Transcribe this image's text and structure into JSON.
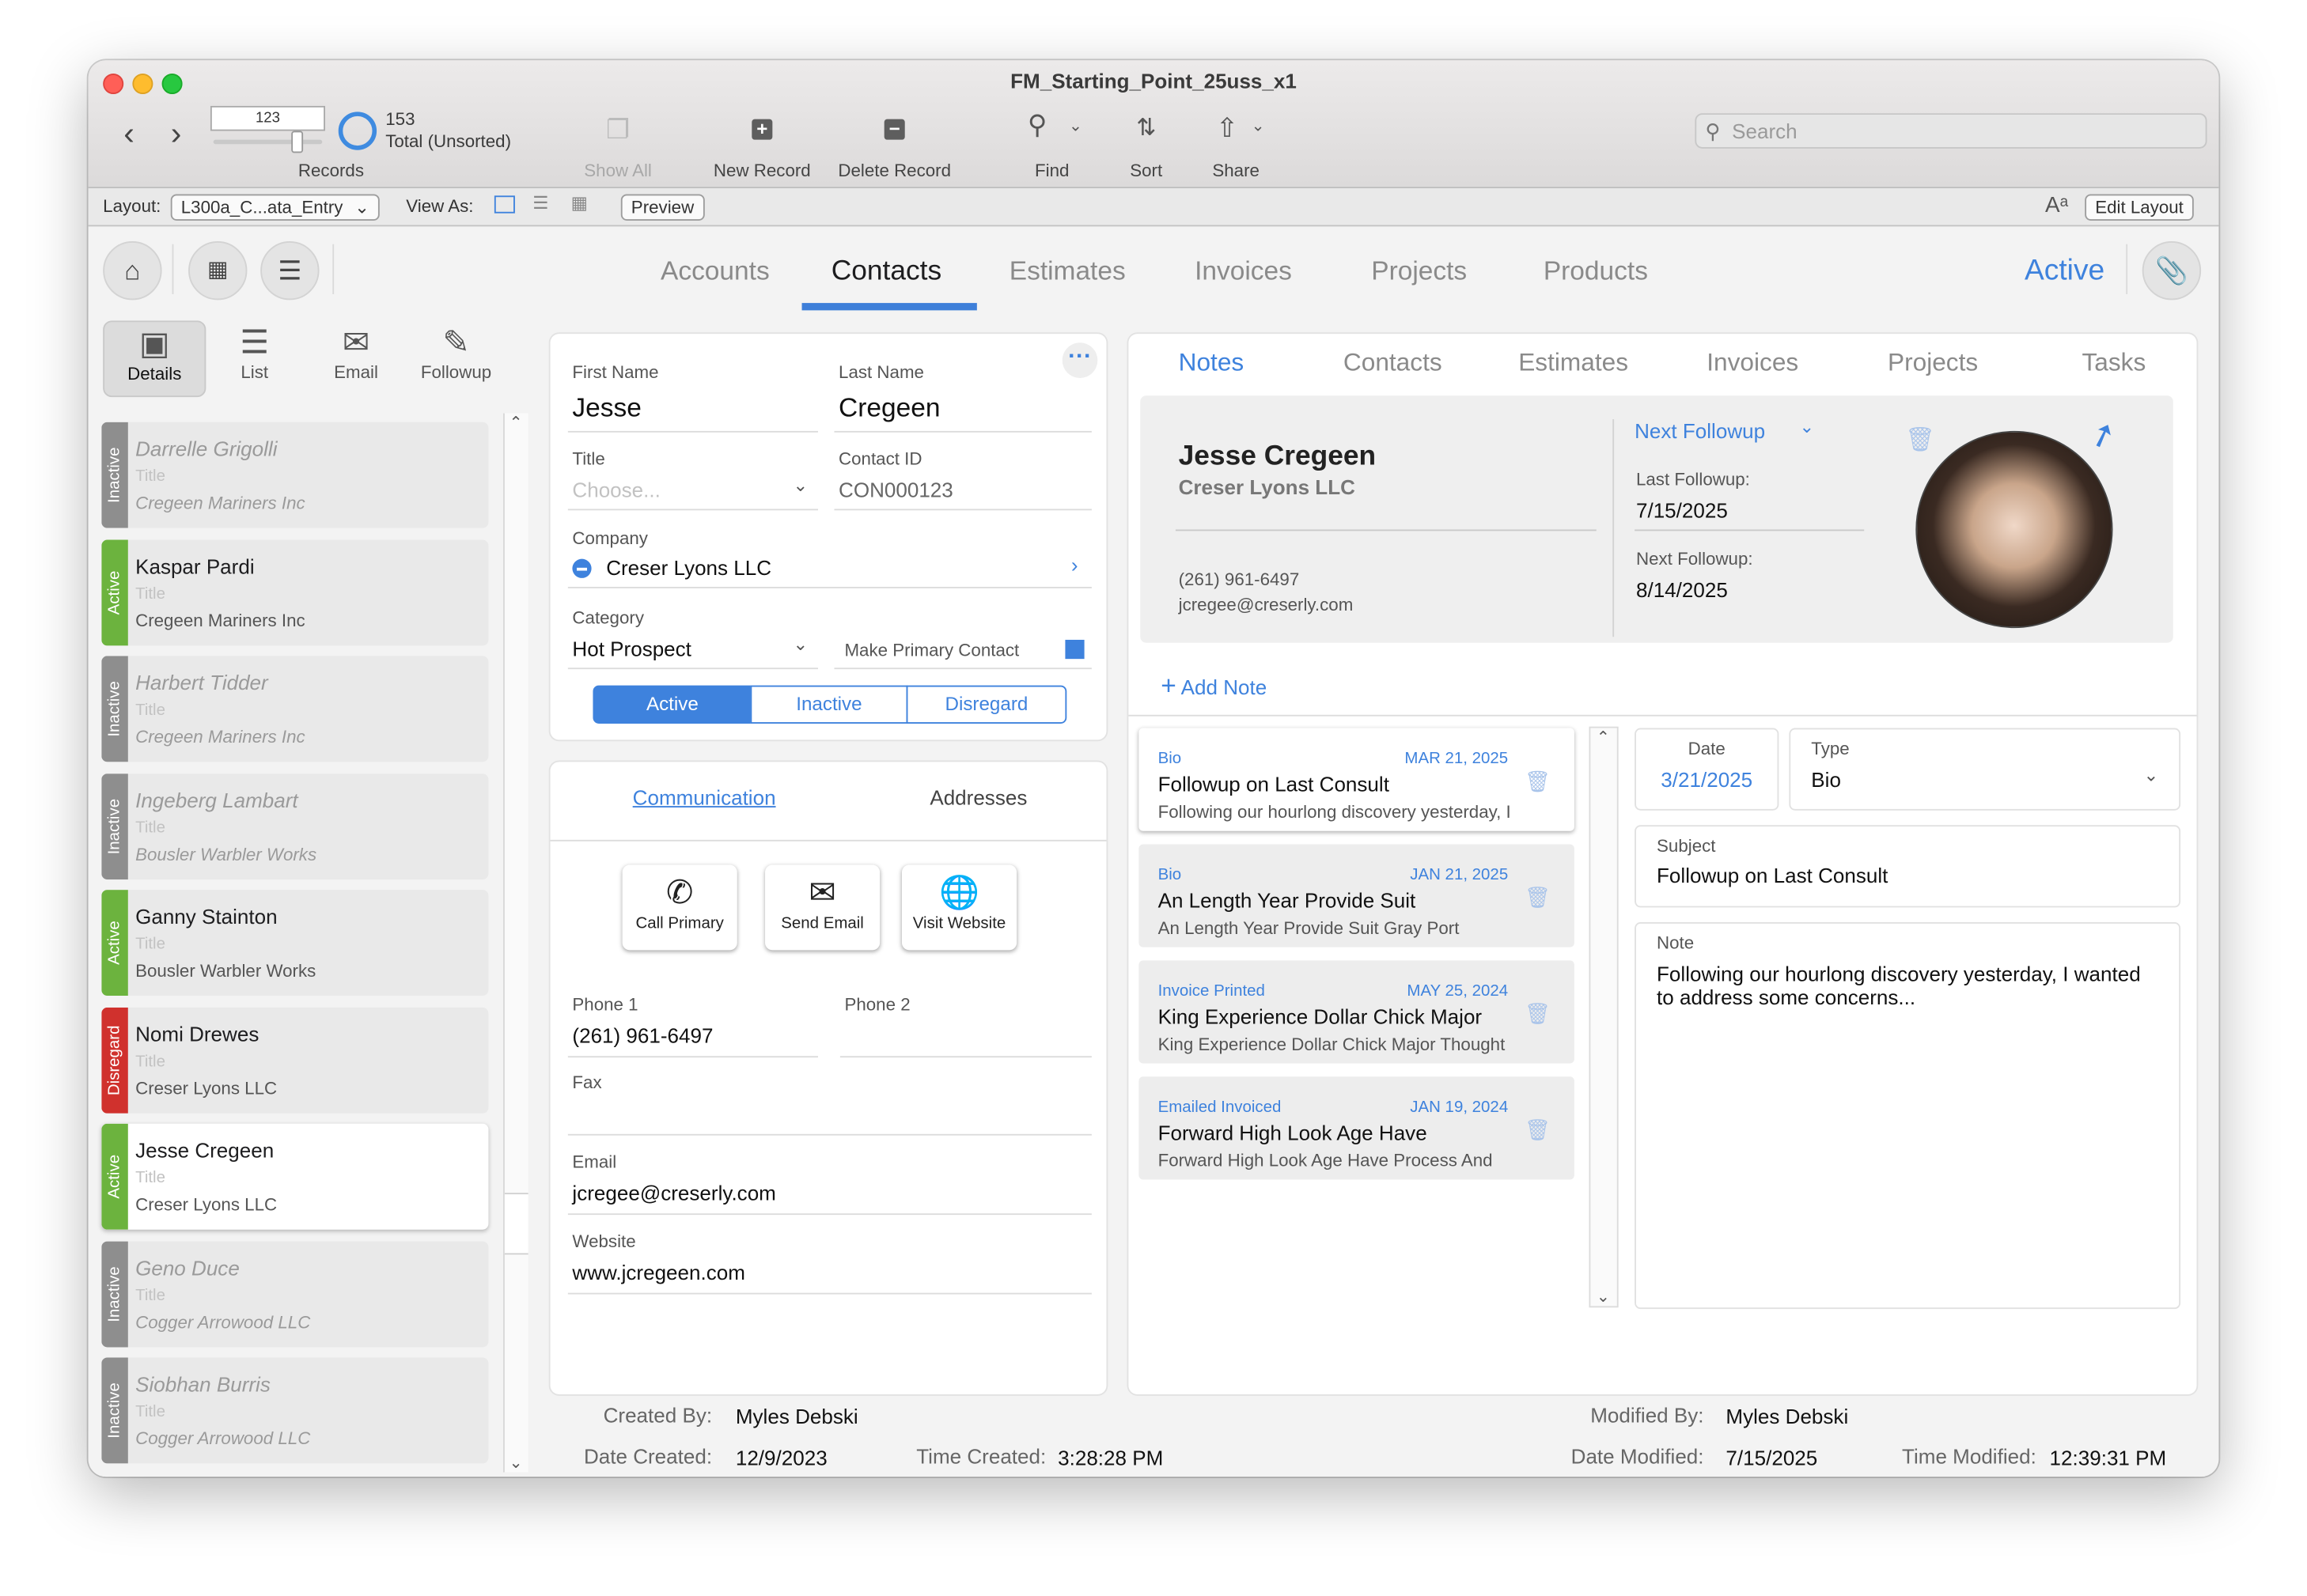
{
  "window": {
    "title": "FM_Starting_Point_25uss_x1"
  },
  "toolbar": {
    "record_number": "123",
    "records_label": "Records",
    "total_count": "153",
    "total_state": "Total (Unsorted)",
    "show_all": "Show All",
    "new_record": "New Record",
    "delete_record": "Delete Record",
    "find": "Find",
    "sort": "Sort",
    "share": "Share",
    "search_placeholder": "Search"
  },
  "layoutbar": {
    "layout_label": "Layout:",
    "layout_value": "L300a_C...ata_Entry",
    "view_as_label": "View As:",
    "preview": "Preview",
    "edit_layout": "Edit Layout"
  },
  "nav": {
    "tabs": [
      "Accounts",
      "Contacts",
      "Estimates",
      "Invoices",
      "Projects",
      "Products"
    ],
    "active_tab": "Contacts",
    "status": "Active"
  },
  "sidebar": {
    "tabs": [
      "Details",
      "List",
      "Email",
      "Followup"
    ],
    "contacts": [
      {
        "name": "Darrelle Grigolli",
        "title": "Title",
        "company": "Cregeen Mariners Inc",
        "status": "Inactive"
      },
      {
        "name": "Kaspar Pardi",
        "title": "Title",
        "company": "Cregeen Mariners Inc",
        "status": "Active"
      },
      {
        "name": "Harbert Tidder",
        "title": "Title",
        "company": "Cregeen Mariners Inc",
        "status": "Inactive"
      },
      {
        "name": "Ingeberg Lambart",
        "title": "Title",
        "company": "Bousler Warbler Works",
        "status": "Inactive"
      },
      {
        "name": "Ganny Stainton",
        "title": "Title",
        "company": "Bousler Warbler Works",
        "status": "Active"
      },
      {
        "name": "Nomi Drewes",
        "title": "Title",
        "company": "Creser Lyons LLC",
        "status": "Disregard"
      },
      {
        "name": "Jesse Cregeen",
        "title": "Title",
        "company": "Creser Lyons LLC",
        "status": "Active"
      },
      {
        "name": "Geno Duce",
        "title": "Title",
        "company": "Cogger Arrowood LLC",
        "status": "Inactive"
      },
      {
        "name": "Siobhan Burris",
        "title": "Title",
        "company": "Cogger Arrowood LLC",
        "status": "Inactive"
      }
    ]
  },
  "contact": {
    "first_name_label": "First Name",
    "first_name": "Jesse",
    "last_name_label": "Last Name",
    "last_name": "Cregeen",
    "title_label": "Title",
    "title_placeholder": "Choose...",
    "contact_id_label": "Contact ID",
    "contact_id": "CON000123",
    "company_label": "Company",
    "company": "Creser Lyons LLC",
    "category_label": "Category",
    "category": "Hot Prospect",
    "make_primary_label": "Make Primary Contact",
    "status_options": [
      "Active",
      "Inactive",
      "Disregard"
    ]
  },
  "communication": {
    "tabs": [
      "Communication",
      "Addresses"
    ],
    "buttons": [
      "Call Primary",
      "Send Email",
      "Visit Website"
    ],
    "phone1_label": "Phone 1",
    "phone1": "(261) 961-6497",
    "phone2_label": "Phone 2",
    "phone2": "",
    "fax_label": "Fax",
    "fax": "",
    "email_label": "Email",
    "email": "jcregee@creserly.com",
    "website_label": "Website",
    "website": "www.jcregeen.com"
  },
  "notes_panel": {
    "tabs": [
      "Notes",
      "Contacts",
      "Estimates",
      "Invoices",
      "Projects",
      "Tasks"
    ],
    "summary": {
      "name": "Jesse Cregeen",
      "company": "Creser Lyons LLC",
      "phone": "(261) 961-6497",
      "email": "jcregee@creserly.com",
      "next_followup_label": "Next Followup",
      "last_followup_label": "Last Followup:",
      "last_followup": "7/15/2025",
      "next_followup_date_label": "Next Followup:",
      "next_followup": "8/14/2025"
    },
    "add_note": "Add Note",
    "notes": [
      {
        "type": "Bio",
        "date": "MAR 21, 2025",
        "title": "Followup on Last Consult",
        "summary": "Following our hourlong discovery yesterday, I"
      },
      {
        "type": "Bio",
        "date": "JAN 21, 2025",
        "title": "An Length Year Provide Suit",
        "summary": "An Length Year Provide Suit Gray Port"
      },
      {
        "type": "Invoice Printed",
        "date": "MAY 25, 2024",
        "title": "King Experience Dollar Chick Major",
        "summary": "King Experience Dollar Chick Major Thought"
      },
      {
        "type": "Emailed Invoiced",
        "date": "JAN 19, 2024",
        "title": "Forward High Look Age Have",
        "summary": "Forward High Look Age Have Process And"
      }
    ],
    "detail": {
      "date_label": "Date",
      "date": "3/21/2025",
      "type_label": "Type",
      "type": "Bio",
      "subject_label": "Subject",
      "subject": "Followup on Last Consult",
      "note_label": "Note",
      "note": "Following our hourlong discovery yesterday, I wanted to address some concerns..."
    }
  },
  "footer": {
    "created_by_label": "Created By:",
    "created_by": "Myles Debski",
    "date_created_label": "Date Created:",
    "date_created": "12/9/2023",
    "time_created_label": "Time Created:",
    "time_created": "3:28:28 PM",
    "modified_by_label": "Modified By:",
    "modified_by": "Myles Debski",
    "date_modified_label": "Date Modified:",
    "date_modified": "7/15/2025",
    "time_modified_label": "Time Modified:",
    "time_modified": "12:39:31 PM"
  },
  "colors": {
    "accent": "#3e82dd",
    "status_active": "#6cb33e",
    "status_inactive": "#8e8e8e",
    "status_disregard": "#d0312d"
  },
  "icons": {
    "home": "home-icon",
    "calendar": "calendar-icon",
    "list": "list-icon",
    "paperclip": "paperclip-icon",
    "phone": "phone-icon",
    "mail": "mail-icon",
    "globe": "globe-icon",
    "trash": "trash-icon"
  }
}
